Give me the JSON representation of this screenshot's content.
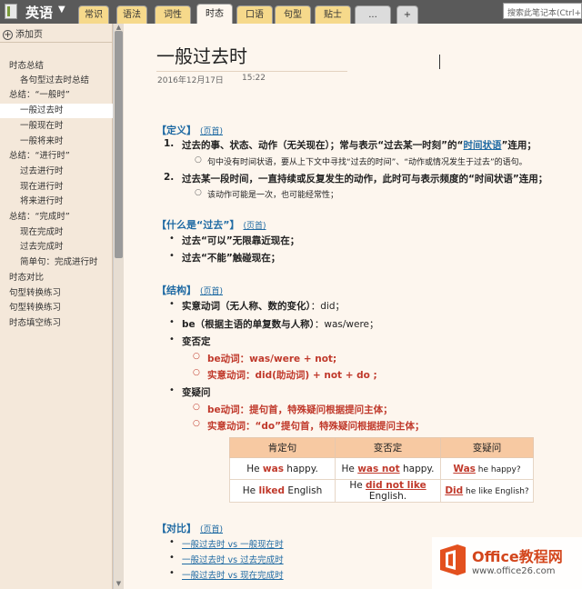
{
  "notebook": {
    "title": "英语"
  },
  "tabs": [
    "常识",
    "语法",
    "词性",
    "时态",
    "口语",
    "句型",
    "贴士",
    "...",
    "+"
  ],
  "search": {
    "placeholder": "搜索此笔记本(Ctrl+E)"
  },
  "sidebar": {
    "add_page": "添加页",
    "pages": [
      "时态总结",
      "各句型过去时总结",
      "总结：“一般时”",
      "一般过去时",
      "一般现在时",
      "一般将来时",
      "总结：“进行时”",
      "过去进行时",
      "现在进行时",
      "将来进行时",
      "总结：“完成时”",
      "现在完成时",
      "过去完成时",
      "简单句：完成进行时",
      "时态对比",
      "句型转换练习",
      "句型转换练习",
      "时态填空练习"
    ]
  },
  "page": {
    "title": "一般过去时",
    "date": "2016年12月17日",
    "time": "15:22",
    "top_link": "(页首)",
    "definition": {
      "heading": "【定义】",
      "item1_num": "1.",
      "item1_a": "过去的事、状态、动作（无关现在）；常与表示“过去某一时刻”的“",
      "item1_link": "时间状语",
      "item1_b": "”连用；",
      "item1_sub": "句中没有时间状语，要从上下文中寻找“过去的时间”、“动作或情况发生于过去”的语句。",
      "item2_num": "2.",
      "item2": "过去某一段时间，一直持续或反复发生的动作，此时可与表示频度的“时间状语”连用；",
      "item2_sub": "该动作可能是一次，也可能经常性；"
    },
    "what_past": {
      "heading": "【什么是“过去”】",
      "b1": "过去“可以”无限靠近现在；",
      "b2": "过去“不能”触碰现在；"
    },
    "structure": {
      "heading": "【结构】",
      "b1_label": "实意动词（无人称、数的变化）",
      "b1_value": "：did；",
      "b2_label": "be（根据主语的单复数与人称）",
      "b2_value": "：was/were；",
      "b3": "变否定",
      "b3_s1": "be动词：was/were + not;",
      "b3_s2": "实意动词：did(助动词) + not + do ;",
      "b4": "变疑问",
      "b4_s1": "be动词：提句首，特殊疑问根据提问主体；",
      "b4_s2": "实意动词：“do”提句首，特殊疑问根据提问主体；"
    },
    "table": {
      "headers": [
        "肯定句",
        "变否定",
        "变疑问"
      ],
      "r1": {
        "c1a": "He ",
        "c1b": "was",
        "c1c": " happy.",
        "c2a": "He ",
        "c2b": "was not",
        "c2c": " happy.",
        "c3a": "Was",
        "c3b": " he happy?"
      },
      "r2": {
        "c1a": "He ",
        "c1b": "liked",
        "c1c": " English",
        "c2a": "He ",
        "c2b": "did not like",
        "c2c": " English.",
        "c3a": "Did",
        "c3b": " he like English?"
      }
    },
    "compare": {
      "heading": "【对比】",
      "links": [
        "一般过去时 vs 一般现在时",
        "一般过去时 vs 过去完成时",
        "一般过去时 vs 现在完成时"
      ]
    }
  },
  "watermark": {
    "line1": "Office教程网",
    "line2": "www.office26.com"
  },
  "colors": {
    "accent_blue": "#1f6aa3",
    "accent_red": "#c0392b",
    "table_header": "#f7c9a2"
  }
}
